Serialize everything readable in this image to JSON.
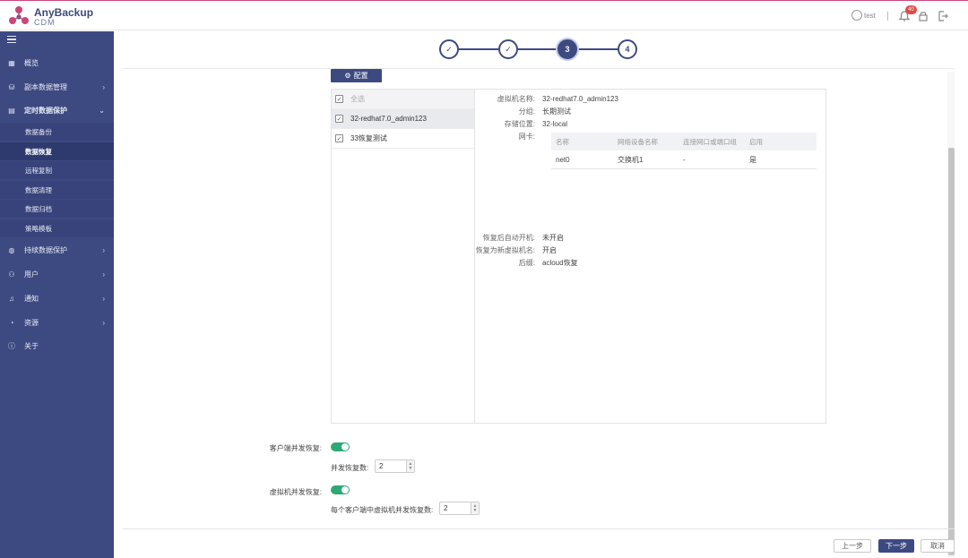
{
  "app": {
    "brand_name": "AnyBackup",
    "brand_sub": "CDM",
    "user": "test",
    "notifications": "40"
  },
  "sidebar": {
    "items": [
      {
        "label": "概览",
        "icon": "grid-icon"
      },
      {
        "label": "副本数据管理",
        "icon": "database-icon"
      },
      {
        "label": "定时数据保护",
        "icon": "archive-icon"
      },
      {
        "label": "持续数据保护",
        "icon": "globe-icon"
      },
      {
        "label": "用户",
        "icon": "user-icon"
      },
      {
        "label": "通知",
        "icon": "bell-icon"
      },
      {
        "label": "资源",
        "icon": "pie-icon"
      },
      {
        "label": "关于",
        "icon": "info-icon"
      }
    ],
    "subitems": [
      "数据备份",
      "数据恢复",
      "远程复制",
      "数据清理",
      "数据归档",
      "策略模板"
    ]
  },
  "steps": [
    "✓",
    "✓",
    "3",
    "4"
  ],
  "config_button": "配置",
  "vm_list": {
    "select_all": "全选",
    "items": [
      "32-redhat7.0_admin123",
      "33恢复测试"
    ]
  },
  "detail": {
    "vm_name_label": "虚拟机名称:",
    "vm_name": "32-redhat7.0_admin123",
    "group_label": "分组:",
    "group": "长期测试",
    "storage_label": "存储位置:",
    "storage": "32-local",
    "nic_label": "网卡:",
    "nic_headers": [
      "名称",
      "网络设备名称",
      "连接网口或端口组",
      "启用"
    ],
    "nic_row": [
      "net0",
      "交换机1",
      "-",
      "是"
    ],
    "autostart_label": "恢复后自动开机:",
    "autostart": "未开启",
    "newvm_label": "恢复为新虚拟机名:",
    "newvm": "开启",
    "suffix_label": "后缀:",
    "suffix": "acloud恢复"
  },
  "form": {
    "client_concurrent_label": "客户端并发恢复:",
    "concurrent_count_label": "并发恢复数:",
    "concurrent_count": "2",
    "vm_concurrent_label": "虚拟机并发恢复:",
    "per_client_label": "每个客户端中虚拟机并发恢复数:",
    "per_client_count": "2"
  },
  "footer": {
    "prev": "上一步",
    "next": "下一步",
    "cancel": "取消"
  }
}
